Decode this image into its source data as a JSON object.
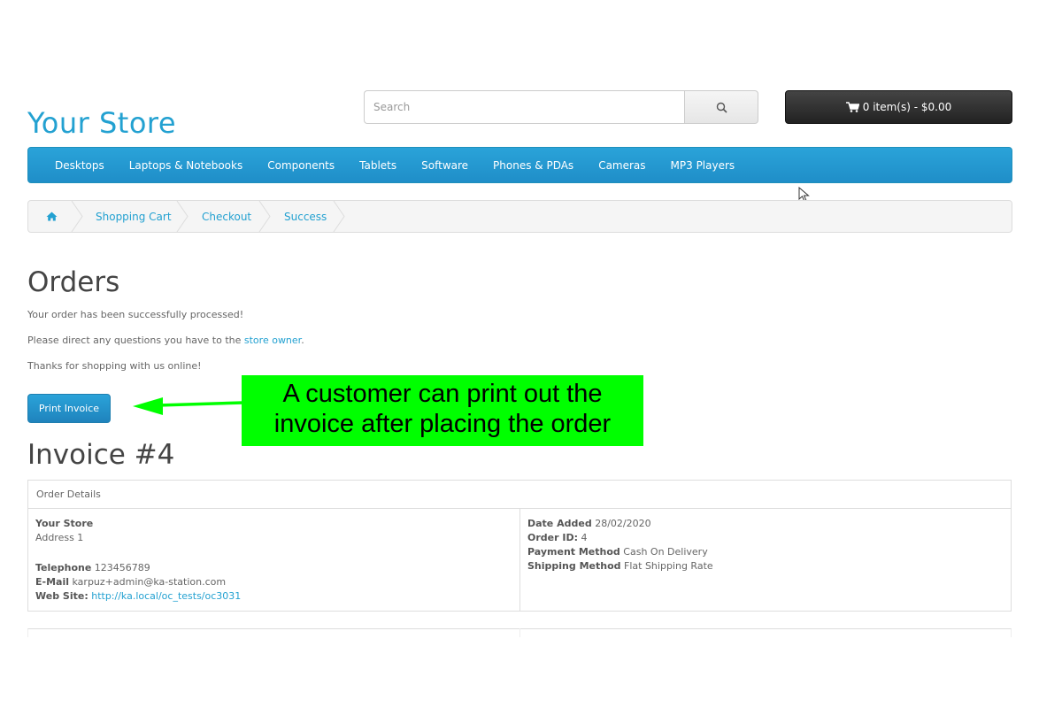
{
  "header": {
    "logo": "Your Store",
    "search_placeholder": "Search",
    "cart_label": "0 item(s) - $0.00"
  },
  "menu": {
    "items": [
      "Desktops",
      "Laptops & Notebooks",
      "Components",
      "Tablets",
      "Software",
      "Phones & PDAs",
      "Cameras",
      "MP3 Players"
    ]
  },
  "breadcrumb": {
    "items": [
      "Shopping Cart",
      "Checkout",
      "Success"
    ]
  },
  "main": {
    "title": "Orders",
    "line1": "Your order has been successfully processed!",
    "line2_prefix": "Please direct any questions you have to the ",
    "line2_link": "store owner",
    "line2_suffix": ".",
    "line3": "Thanks for shopping with us online!",
    "print_button": "Print Invoice"
  },
  "annotation": {
    "line1": "A customer can print out the",
    "line2": "invoice after placing the order",
    "colors": {
      "box": "#00ff00",
      "arrow": "#00ff00"
    }
  },
  "invoice": {
    "title": "Invoice #4",
    "header": "Order Details",
    "store_name": "Your Store",
    "address": "Address 1",
    "telephone_label": "Telephone",
    "telephone": "123456789",
    "email_label": "E-Mail",
    "email": "karpuz+admin@ka-station.com",
    "website_label": "Web Site:",
    "website": "http://ka.local/oc_tests/oc3031",
    "date_added_label": "Date Added",
    "date_added": "28/02/2020",
    "order_id_label": "Order ID:",
    "order_id": "4",
    "payment_method_label": "Payment Method",
    "payment_method": "Cash On Delivery",
    "shipping_method_label": "Shipping Method",
    "shipping_method": "Flat Shipping Rate"
  },
  "colors": {
    "accent": "#23a1d1",
    "menu": "#229ac8",
    "cart": "#303030"
  }
}
